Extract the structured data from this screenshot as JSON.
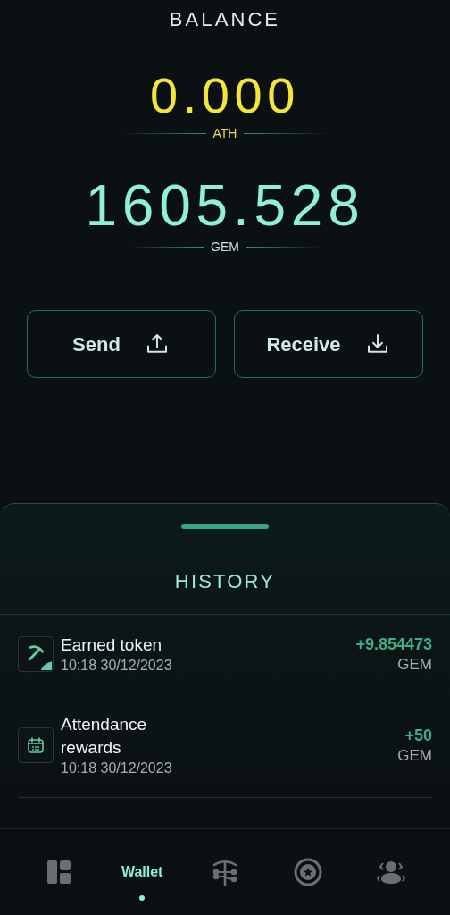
{
  "title": "BALANCE",
  "balances": [
    {
      "amount": "0.000",
      "unit": "ATH",
      "kind": "ath"
    },
    {
      "amount": "1605.528",
      "unit": "GEM",
      "kind": "gem"
    }
  ],
  "actions": [
    {
      "label": "Send",
      "kind": "send"
    },
    {
      "label": "Receive",
      "kind": "receive"
    }
  ],
  "history": {
    "title": "HISTORY",
    "items": [
      {
        "kind": "mining",
        "title": "Earned token",
        "time": "10:18 30/12/2023",
        "amount": "+9.854473",
        "unit": "GEM"
      },
      {
        "kind": "calendar",
        "title": "Attendance rewards",
        "time": "10:18 30/12/2023",
        "amount": "+50",
        "unit": "GEM"
      }
    ]
  },
  "nav": [
    {
      "kind": "dashboard",
      "selected": false
    },
    {
      "label": "Wallet",
      "selected": true
    },
    {
      "kind": "mining",
      "selected": false
    },
    {
      "kind": "badge",
      "selected": false
    },
    {
      "kind": "people",
      "selected": false
    }
  ]
}
